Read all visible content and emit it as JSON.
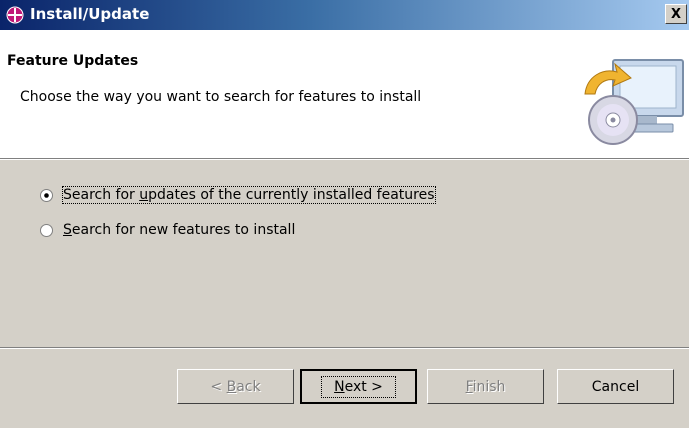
{
  "window": {
    "title": "Install/Update",
    "close_glyph": "X"
  },
  "banner": {
    "title": "Feature Updates",
    "description": "Choose the way you want to search for features to install",
    "graphic_icon": "install-monitor-cd-icon"
  },
  "options": [
    {
      "pre": "Search for ",
      "mnemonic": "u",
      "post": "pdates of the currently installed features",
      "selected": true
    },
    {
      "pre": "",
      "mnemonic": "S",
      "post": "earch for new features to install",
      "selected": false
    }
  ],
  "buttons": {
    "back": {
      "pre": "< ",
      "mnemonic": "B",
      "post": "ack",
      "enabled": false
    },
    "next": {
      "pre": "",
      "mnemonic": "N",
      "post": "ext >",
      "enabled": true
    },
    "finish": {
      "pre": "",
      "mnemonic": "F",
      "post": "inish",
      "enabled": false
    },
    "cancel": {
      "label": "Cancel",
      "enabled": true
    }
  },
  "colors": {
    "titlebar_start": "#0a246a",
    "titlebar_end": "#a6caf0",
    "dialog_face": "#d4d0c8",
    "disabled_text": "#808080"
  }
}
